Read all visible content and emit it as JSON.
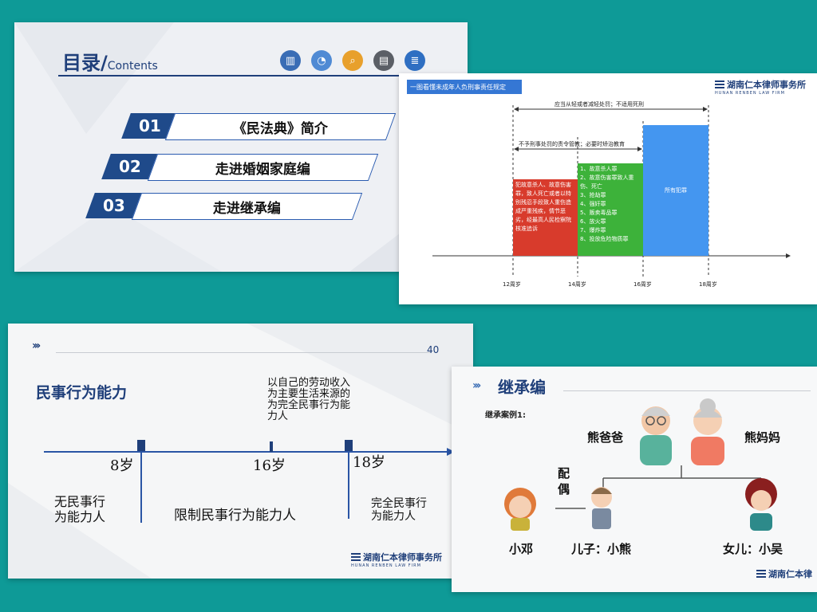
{
  "slide1": {
    "title": "目录/",
    "title_small": "Contents",
    "icons": [
      "bar-chart-icon",
      "pie-chart-icon",
      "search-icon",
      "notebook-icon",
      "document-icon"
    ],
    "items": [
      {
        "num": "01",
        "label": "《民法典》简介"
      },
      {
        "num": "02",
        "label": "走进婚姻家庭编"
      },
      {
        "num": "03",
        "label": "走进继承编"
      }
    ]
  },
  "slide2": {
    "header": "一图看懂未成年人负刑事责任规定",
    "logo": "湖南仁本律师事务所",
    "logo_sub": "HUNAN RENBEN LAW FIRM",
    "arrow1": "应当从轻或者减轻处罚；不适用死刑",
    "arrow2": "不予刑事处罚的责令管教；必要时矫治教育",
    "red_text": "犯故意杀人、故意伤害罪，致人死亡或者以特别残忍手段致人重伤造成严重残疾，情节恶劣，经最高人民检察院核准追诉",
    "green_text": "1、故意杀人罪\n2、故意伤害罪致人重伤、死亡\n3、抢劫罪\n4、强奸罪\n5、贩卖毒品罪\n6、放火罪\n7、爆炸罪\n8、投放危险物质罪",
    "blue_text": "所有犯罪",
    "ticks": [
      "12周岁",
      "14周岁",
      "16周岁",
      "18周岁"
    ]
  },
  "slide3": {
    "page": "40",
    "title": "民事行为能力",
    "note": "以自己的劳动收入为主要生活来源的为完全民事行为能力人",
    "ages": [
      "8岁",
      "16岁",
      "18岁"
    ],
    "seg1": "无民事行\n为能力人",
    "seg2": "限制民事行为能力人",
    "seg3": "完全民事行\n为能力人",
    "logo": "湖南仁本律师事务所",
    "logo_sub": "HUNAN RENBEN LAW FIRM"
  },
  "slide4": {
    "title": "继承编",
    "case": "继承案例1:",
    "father": "熊爸爸",
    "mother": "熊妈妈",
    "spouse": "配\n偶",
    "p1": "小邓",
    "p2": "儿子：小熊",
    "p3": "女儿：小吴",
    "logo": "湖南仁本律"
  }
}
